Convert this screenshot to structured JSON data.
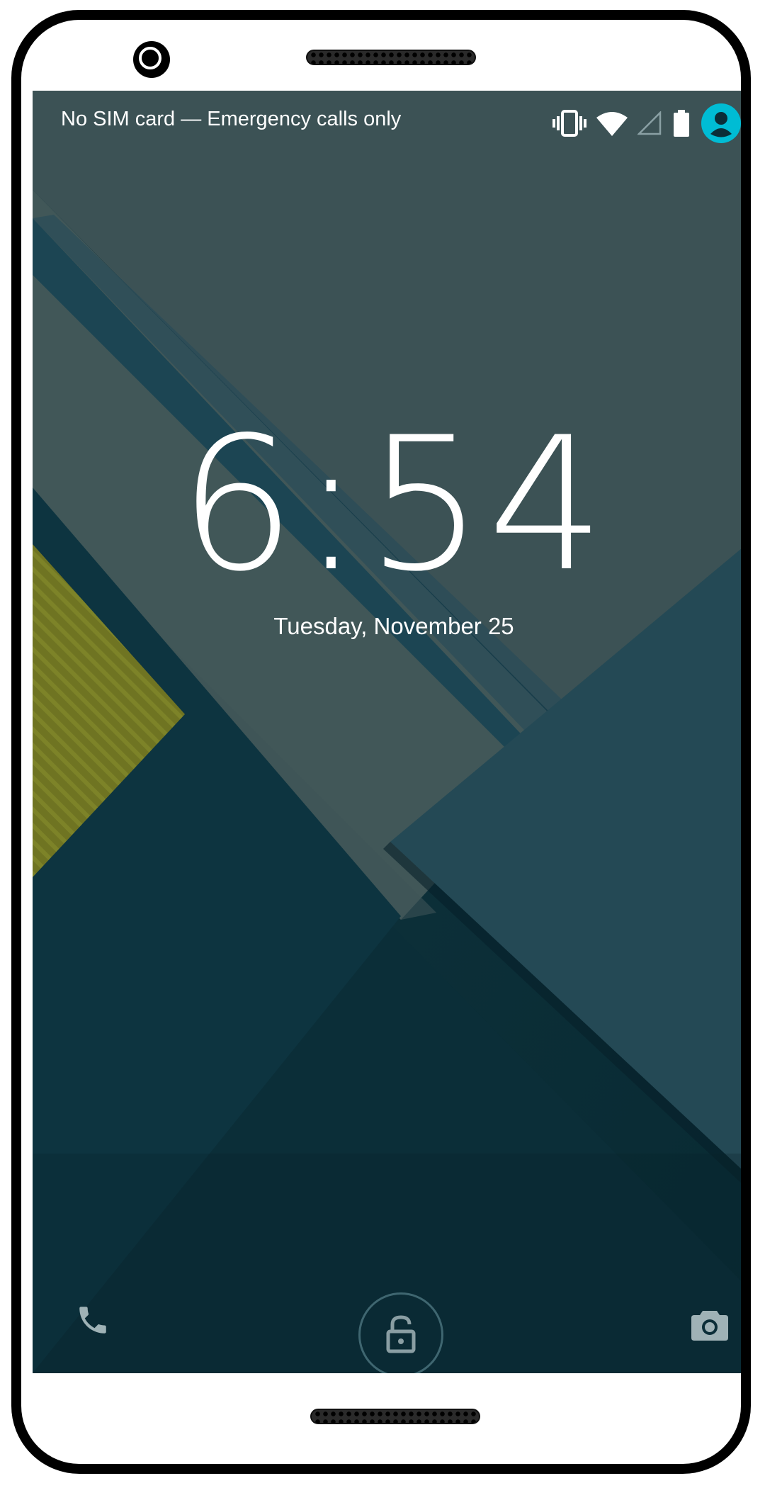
{
  "status_bar": {
    "carrier_text": "No SIM card — Emergency calls only",
    "icons": [
      "vibrate-icon",
      "wifi-icon",
      "signal-icon",
      "battery-icon",
      "user-avatar-icon"
    ],
    "avatar_color": "#00bcd4"
  },
  "lockscreen": {
    "time": "6:54",
    "date": "Tuesday, November 25"
  },
  "bottom_actions": {
    "left": "phone-icon",
    "center": "unlock-icon",
    "right": "camera-icon"
  },
  "colors": {
    "wallpaper_base": "#0c2f3a",
    "wallpaper_mid": "#3e5457",
    "wallpaper_accent": "#7a7f23"
  }
}
